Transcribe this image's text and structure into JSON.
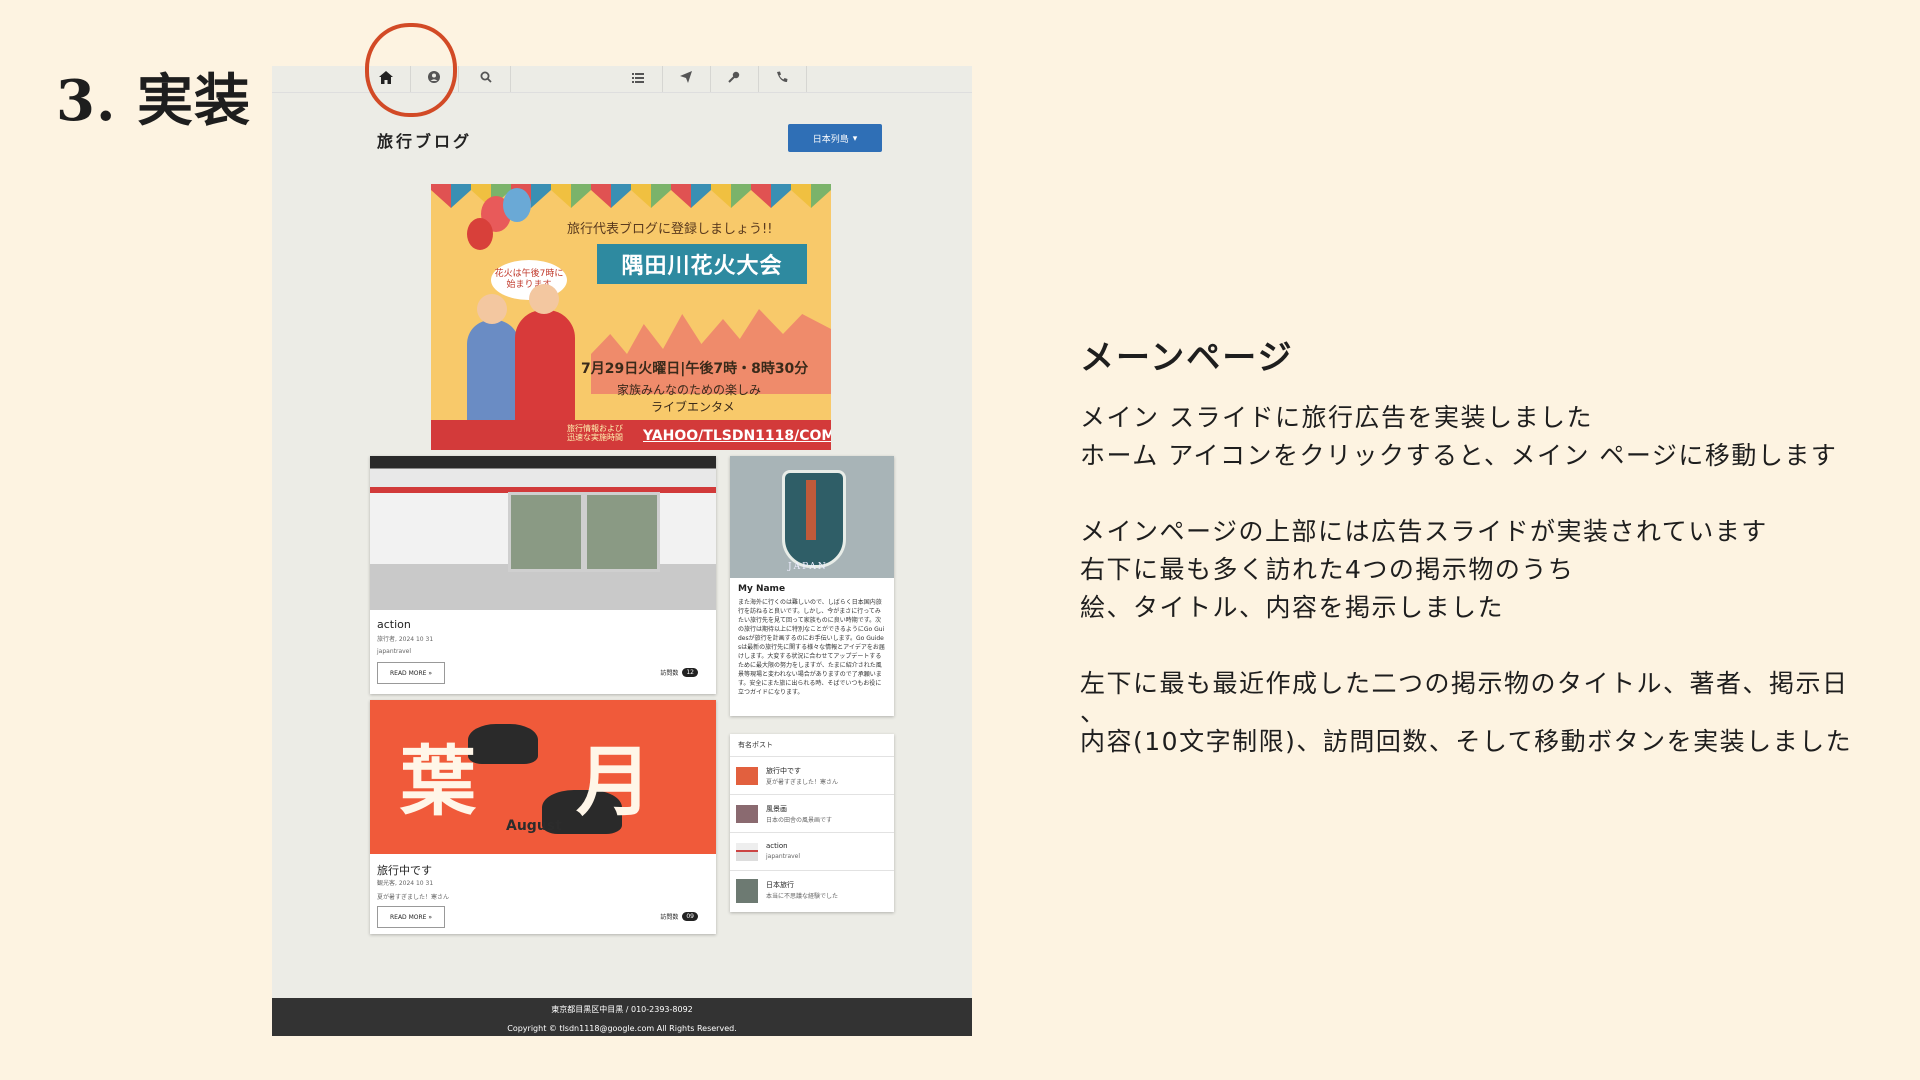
{
  "slide": {
    "title": "3. 実装"
  },
  "nav": {
    "icons": [
      "home-icon",
      "user-icon",
      "search-icon",
      "list-icon",
      "send-icon",
      "key-icon",
      "phone-icon"
    ]
  },
  "blog": {
    "title": "旅行ブログ",
    "language_button": "日本列島"
  },
  "banner": {
    "tagline": "旅行代表ブログに登録しましょう!!",
    "event": "隅田川花火大会",
    "bubble": "花火は午後7時に始まります",
    "date": "7月29日火曜日|午後7時・8時30分",
    "line1": "家族みんなのための楽しみ",
    "line2": "ライブエンタメ",
    "info": "旅行情報および迅速な実施時間",
    "url": "YAHOO/TLSDN1118/COM"
  },
  "posts": [
    {
      "title": "action",
      "meta": "旅行者, 2024 10 31",
      "desc": "japantravel",
      "more": "READ MORE »",
      "visits_label": "訪問数",
      "visits": "12"
    },
    {
      "title": "旅行中です",
      "meta": "観光客, 2024 10 31",
      "desc": "夏が暑すぎました！寒さん",
      "more": "READ MORE »",
      "visits_label": "訪問数",
      "visits": "09",
      "art_text": "August"
    }
  ],
  "profile": {
    "badge_label": "JAPAN",
    "name": "My Name",
    "bio": "また海外に行くのは難しいので、しばらく日本国内旅行を訪ねると良いです。しかし、今がまさに行ってみたい旅行先を見て回って家族ものに良い時期です。次の旅行は期待以上に特別なことができるようにGo Guidesが旅行を計画するのにお手伝いします。Go Guidesは最新の旅行先に関する様々な情報とアイデアをお届けします。大変する状況に合わせてアップデートするために最大限の努力をしますが、たまに紹介された風景等現場と変われない場合がありますので了承願います。安全にまた旅に出られる時、そばでいつもお役に立つガイドになります。"
  },
  "popular": {
    "heading": "有名ポスト",
    "items": [
      {
        "title": "旅行中です",
        "desc": "夏が暑すぎました！寒さん"
      },
      {
        "title": "風景画",
        "desc": "日本の田舎の風景画です"
      },
      {
        "title": "action",
        "desc": "japantravel"
      },
      {
        "title": "日本旅行",
        "desc": "本当に不思議な経験でした"
      }
    ]
  },
  "footer": {
    "address": "東京都目黒区中目黒 / 010-2393-8092",
    "copyright": "Copyright © tlsdn1118@google.com All Rights Reserved."
  },
  "description": {
    "heading": "メーンページ",
    "p1": "メイン スライドに旅行広告を実装しました",
    "p2": "ホーム アイコンをクリックすると、メイン ページに移動します",
    "p3": "メインページの上部には広告スライドが実装されています",
    "p4": "右下に最も多く訪れた4つの掲示物のうち",
    "p5": "絵、タイトル、内容を掲示しました",
    "p6": "左下に最も最近作成した二つの掲示物のタイトル、著者、掲示日",
    "p7": "、",
    "p8": "内容(10文字制限)、訪問回数、そして移動ボタンを実装しました"
  },
  "colors": {
    "background": "#fdf3e1",
    "highlight": "#d24a26",
    "accent": "#2f6fb6",
    "footer": "#333333"
  }
}
